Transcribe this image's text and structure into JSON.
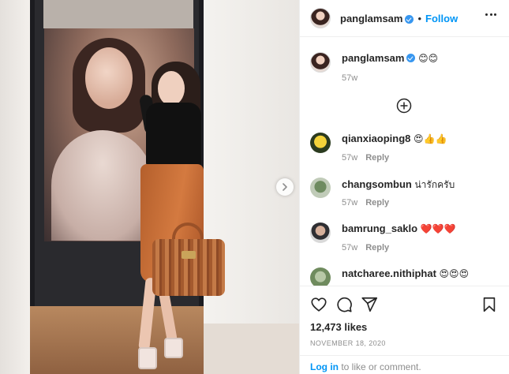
{
  "post": {
    "username": "panglamsam",
    "follow_label": "Follow",
    "separator": "•"
  },
  "caption": {
    "username": "panglamsam",
    "text": "😊😊",
    "time": "57w"
  },
  "comments": [
    {
      "username": "qianxiaoping8",
      "text": "😍👍👍",
      "time": "57w",
      "reply": "Reply"
    },
    {
      "username": "changsombun",
      "text": "น่ารักครับ",
      "time": "57w",
      "reply": "Reply"
    },
    {
      "username": "bamrung_saklo",
      "text": "❤️❤️❤️",
      "time": "57w",
      "reply": "Reply"
    },
    {
      "username": "natcharee.nithiphat",
      "text": "😍😍😍",
      "time": "",
      "reply": ""
    }
  ],
  "likes": "12,473 likes",
  "date": "NOVEMBER 18, 2020",
  "login": {
    "link": "Log in",
    "text": " to like or comment."
  },
  "icons": [
    "heart-icon",
    "comment-icon",
    "share-icon",
    "bookmark-icon",
    "more-options-icon",
    "add-circle-icon",
    "next-arrow-icon",
    "verified-badge-icon"
  ],
  "colors": {
    "accent": "#0095f6",
    "verified": "#3897f0",
    "muted": "#8e8e8e"
  }
}
